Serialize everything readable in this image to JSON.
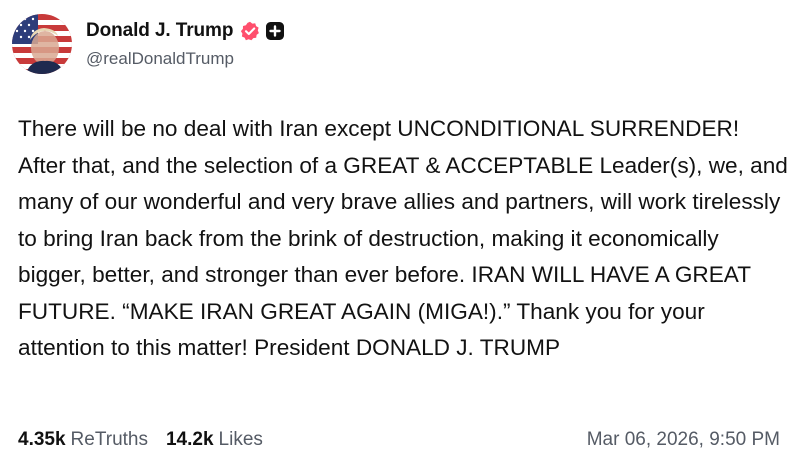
{
  "author": {
    "display_name": "Donald J. Trump",
    "handle": "@realDonaldTrump"
  },
  "icons": {
    "avatar": "profile-photo-flag",
    "verified": "verified-check-badge-icon",
    "plus": "plus-badge-icon"
  },
  "colors": {
    "verified_badge": "#ff4f6d",
    "secondary_text": "#555b65",
    "primary_text": "#111111"
  },
  "post": {
    "text": "There will be no deal with Iran except UNCONDITIONAL SURRENDER! After that, and the selection of a GREAT & ACCEPTABLE Leader(s), we, and many of our wonderful and very brave allies and partners, will work tirelessly to bring Iran back from the brink of destruction, making it economically bigger, better, and stronger than ever before. IRAN WILL HAVE A GREAT FUTURE. “MAKE IRAN GREAT AGAIN (MIGA!).” Thank you for your attention to this matter! President DONALD J. TRUMP"
  },
  "stats": {
    "retruths_count": "4.35k",
    "retruths_label": "ReTruths",
    "likes_count": "14.2k",
    "likes_label": "Likes"
  },
  "timestamp": "Mar 06, 2026, 9:50 PM"
}
